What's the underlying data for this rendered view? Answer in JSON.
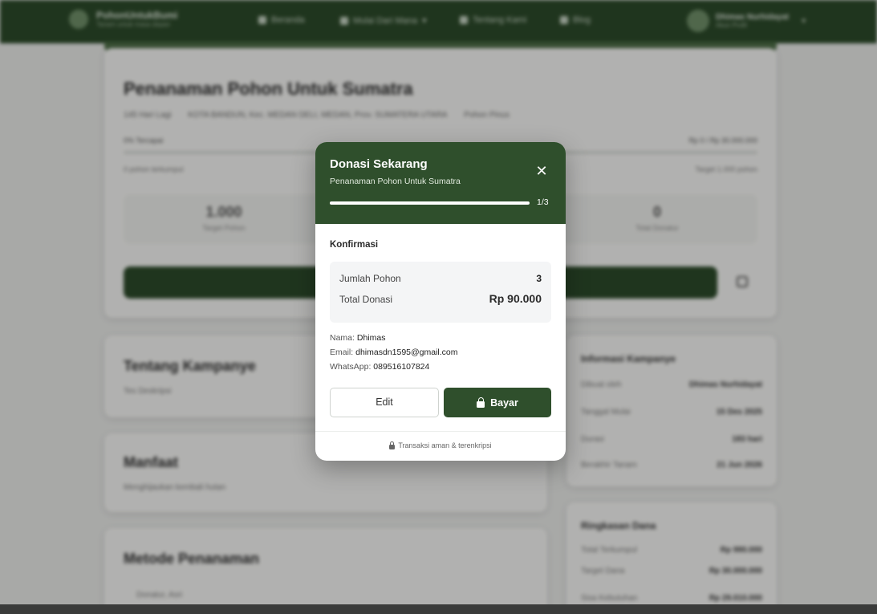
{
  "nav": {
    "brand": "PohonUntukBumi",
    "brand_sub": "Tanam untuk masa depan",
    "items": [
      {
        "label": "Beranda",
        "icon": "home-icon"
      },
      {
        "label": "Mulai Dari Mana",
        "icon": "tree-icon"
      },
      {
        "label": "Tentang Kami",
        "icon": "info-icon"
      },
      {
        "label": "Blog",
        "icon": "book-icon"
      }
    ],
    "user_name": "Dhimas Nurhidayat",
    "user_role": "Akun Profil"
  },
  "campaign": {
    "title": "Penanaman Pohon Untuk Sumatra",
    "meta": [
      "145 Hari Lagi",
      "KOTA BANDUN, Kec. MEDAN DELI, MEDAN, Prov. SUMATERA UTARA",
      "Pohon Pinus"
    ],
    "progress_left": "0% Tercapai",
    "progress_right": "Rp 0 / Rp 30.000.000",
    "sub_left": "0 pohon terkumpul",
    "sub_right": "Target 1.000 pohon",
    "stats": [
      {
        "value": "1.000",
        "label": "Target Pohon"
      },
      {
        "value": "0",
        "label": "Total Donatur"
      }
    ]
  },
  "sections": {
    "about_title": "Tentang Kampanye",
    "about_text": "Tes Deskripsi",
    "benefit_title": "Manfaat",
    "benefit_text": "Menghijaukan kembali hutan",
    "method_title": "Metode Penanaman",
    "method_item": "Donatur, Asri"
  },
  "sidebar": {
    "info_title": "Informasi Kampanye",
    "info_rows": [
      {
        "k": "Dibuat oleh",
        "v": "Dhimas Nurhidayat"
      },
      {
        "k": "Tanggal Mulai",
        "v": "15 Des 2025"
      },
      {
        "k": "Durasi",
        "v": "183 hari"
      },
      {
        "k": "Berakhir Tanam",
        "v": "21 Jun 2026"
      }
    ],
    "fund_title": "Ringkasan Dana",
    "fund_rows": [
      {
        "k": "Total Terkumpul",
        "v": "Rp 990.000"
      },
      {
        "k": "Target Dana",
        "v": "Rp 30.000.000"
      },
      {
        "k": "Sisa Kebutuhan",
        "v": "Rp 29.010.000"
      }
    ]
  },
  "modal": {
    "title": "Donasi Sekarang",
    "subtitle": "Penanaman Pohon Untuk Sumatra",
    "step": "1/3",
    "progress": 1.0,
    "section": "Konfirmasi",
    "tree_label": "Jumlah Pohon",
    "tree_qty": "3",
    "total_label": "Total Donasi",
    "total_amount": "Rp 90.000",
    "name_label": "Nama:",
    "name_value": "Dhimas",
    "email_label": "Email:",
    "email_value": "dhimasdn1595@gmail.com",
    "wa_label": "WhatsApp:",
    "wa_value": "089516107824",
    "edit_label": "Edit",
    "pay_label": "Bayar",
    "secure_text": "Transaksi aman & terenkripsi"
  },
  "colors": {
    "brand_green": "#2f4f2c",
    "nav_green": "#2c4a2a"
  }
}
